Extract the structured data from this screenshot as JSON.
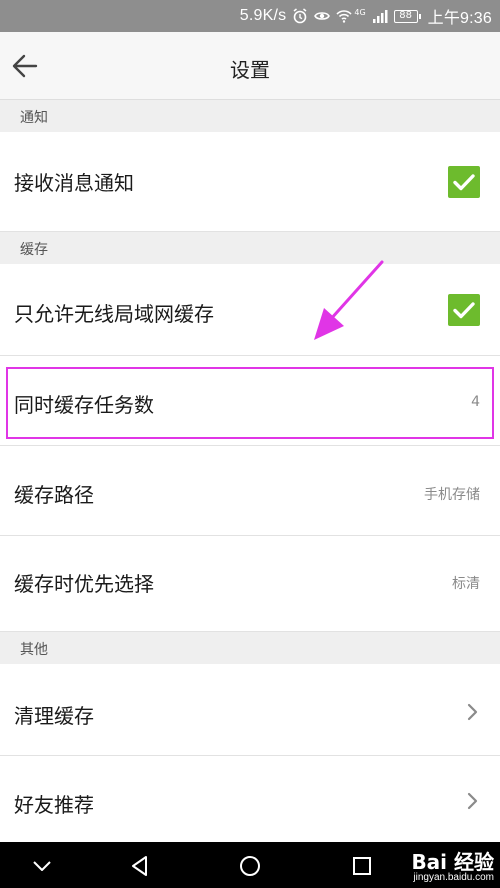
{
  "status_bar": {
    "network_speed": "5.9K/s",
    "network_type": "4G",
    "battery": "88",
    "time": "上午9:36",
    "icons": [
      "alarm-icon",
      "eye-icon",
      "wifi-icon",
      "signal-icon",
      "battery-icon"
    ]
  },
  "app_bar": {
    "title": "设置",
    "back_icon": "back-arrow-icon"
  },
  "sections": {
    "notify": {
      "header": "通知"
    },
    "cache": {
      "header": "缓存"
    },
    "other": {
      "header": "其他"
    }
  },
  "rows": {
    "receive_notifications": {
      "label": "接收消息通知",
      "checked": true
    },
    "wifi_only_cache": {
      "label": "只允许无线局域网缓存",
      "checked": true
    },
    "concurrent_tasks": {
      "label": "同时缓存任务数",
      "value": "4"
    },
    "cache_path": {
      "label": "缓存路径",
      "value": "手机存储"
    },
    "cache_quality": {
      "label": "缓存时优先选择",
      "value": "标清"
    },
    "clear_cache": {
      "label": "清理缓存"
    },
    "recommend_friends": {
      "label": "好友推荐"
    }
  },
  "annotation": {
    "highlight_color": "#e035e6"
  },
  "nav_bar": {
    "buttons": [
      "nav-down-icon",
      "nav-back-icon",
      "nav-home-icon",
      "nav-recent-icon"
    ],
    "watermark": "Bai 经验",
    "watermark_url": "jingyan.baidu.com"
  },
  "colors": {
    "check_green": "#6dbb2d",
    "status_bar": "#8e8e8e",
    "section_bg": "#efefef"
  }
}
